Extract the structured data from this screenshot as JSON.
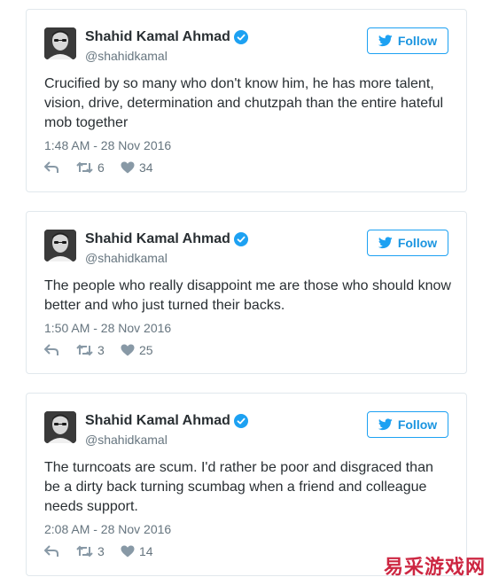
{
  "tweets": [
    {
      "author": {
        "name": "Shahid Kamal Ahmad",
        "handle": "@shahidkamal",
        "verified": true
      },
      "follow_label": "Follow",
      "text": "Crucified by so many who don't know him, he has more talent, vision, drive, determination and chutzpah than the entire hateful mob together",
      "timestamp": "1:48 AM - 28 Nov 2016",
      "retweets": "6",
      "likes": "34"
    },
    {
      "author": {
        "name": "Shahid Kamal Ahmad",
        "handle": "@shahidkamal",
        "verified": true
      },
      "follow_label": "Follow",
      "text": "The people who really disappoint me are those who should know better and who just turned their backs.",
      "timestamp": "1:50 AM - 28 Nov 2016",
      "retweets": "3",
      "likes": "25"
    },
    {
      "author": {
        "name": "Shahid Kamal Ahmad",
        "handle": "@shahidkamal",
        "verified": true
      },
      "follow_label": "Follow",
      "text": "The turncoats are scum. I'd rather be poor and disgraced than be a dirty back turning scumbag when a friend and colleague needs support.",
      "timestamp": "2:08 AM - 28 Nov 2016",
      "retweets": "3",
      "likes": "14"
    }
  ],
  "icons": {
    "verified": "verified-badge-icon",
    "follow": "twitter-bird-icon",
    "reply": "reply-icon",
    "retweet": "retweet-icon",
    "like": "heart-icon"
  },
  "colors": {
    "twitter_blue": "#1da1f2",
    "text": "#292f33",
    "muted": "#66757f",
    "border": "#e1e8ed",
    "watermark": "#c8102e"
  },
  "watermark": "易采游戏网"
}
